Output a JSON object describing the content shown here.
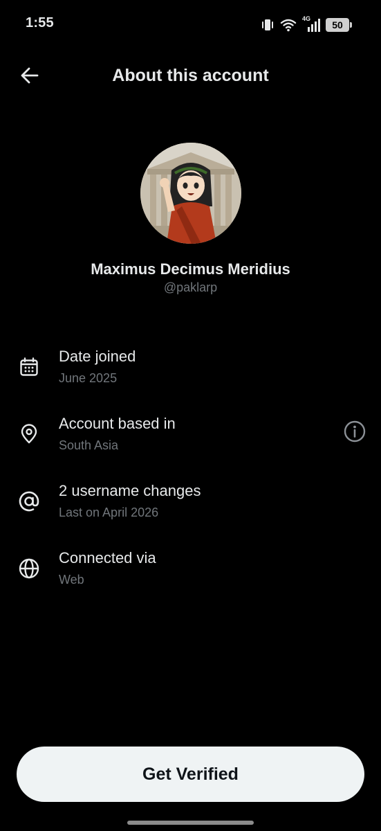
{
  "status_bar": {
    "time": "1:55",
    "network": "4G",
    "battery": "50",
    "icons": [
      "vibrate-icon",
      "wifi-icon",
      "signal-icon",
      "battery-icon"
    ]
  },
  "header": {
    "title": "About this account",
    "back_icon": "arrow-left-icon"
  },
  "profile": {
    "display_name": "Maximus Decimus Meridius",
    "handle": "@paklarp"
  },
  "info_rows": [
    {
      "icon": "calendar-icon",
      "title": "Date joined",
      "subtitle": "June 2025"
    },
    {
      "icon": "location-pin-icon",
      "title": "Account based in",
      "subtitle": "South Asia",
      "action_icon": "info-icon"
    },
    {
      "icon": "at-sign-icon",
      "title": "2 username changes",
      "subtitle": "Last on April 2026"
    },
    {
      "icon": "globe-icon",
      "title": "Connected via",
      "subtitle": "Web"
    }
  ],
  "cta": {
    "label": "Get Verified"
  },
  "colors": {
    "background": "#000000",
    "primary_text": "#e7e9ea",
    "secondary_text": "#71767b",
    "button_bg": "#eff3f4",
    "button_text": "#0f1419"
  }
}
